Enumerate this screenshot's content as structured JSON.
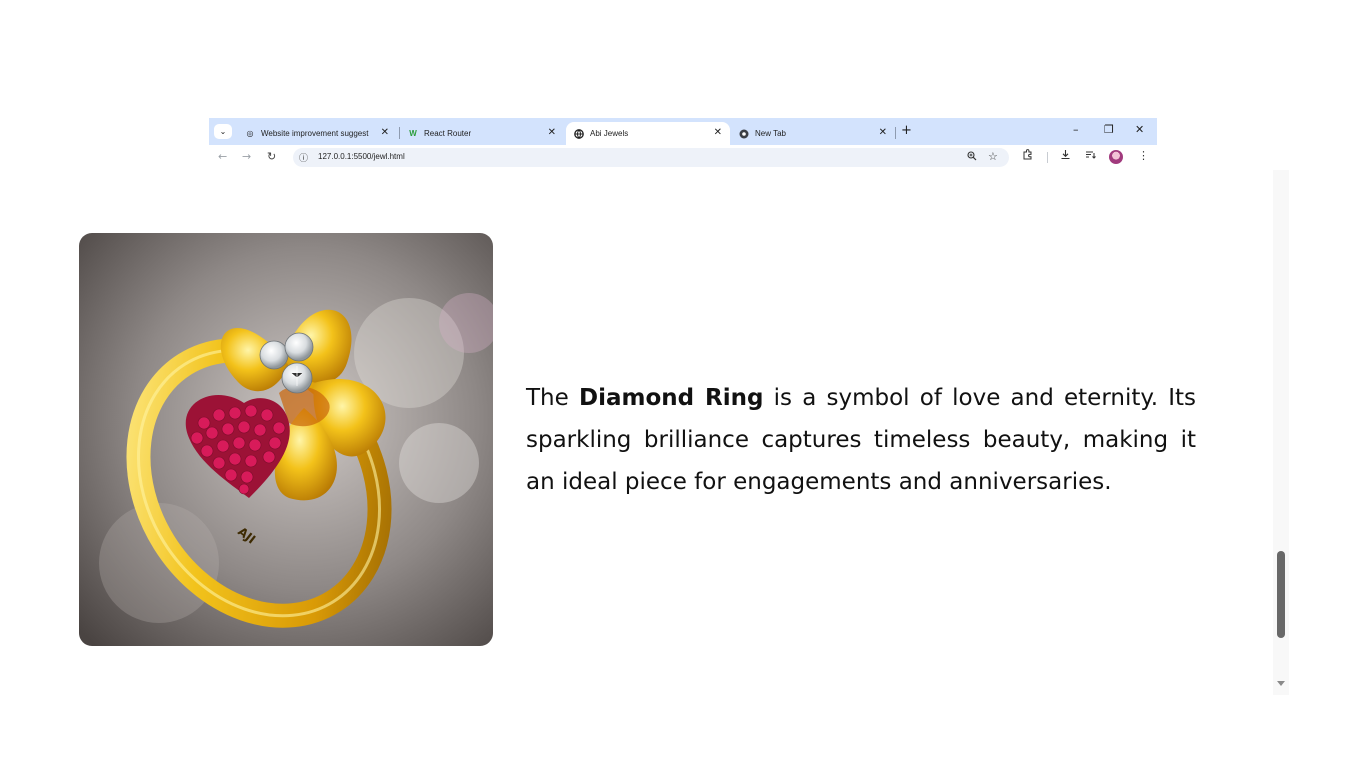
{
  "browser": {
    "tabs": [
      {
        "title": "Website improvement suggesti",
        "favicon": "chatgpt-icon",
        "active": false
      },
      {
        "title": "React Router",
        "favicon": "react-router-icon",
        "active": false
      },
      {
        "title": "Abi Jewels",
        "favicon": "globe-icon",
        "active": true
      },
      {
        "title": "New Tab",
        "favicon": "chrome-icon",
        "active": false
      }
    ],
    "url": "127.0.0.1:5500/jewl.html"
  },
  "product": {
    "image_alt": "gold ring with diamonds and rubies",
    "engraving": "AJI",
    "description_prefix": "The ",
    "description_bold": "Diamond Ring",
    "description_suffix": " is a symbol of love and eternity. Its sparkling brilliance captures timeless beauty, making it an ideal piece for engagements and anniversaries."
  },
  "colors": {
    "tabstrip": "#d3e3fd",
    "gold": "#e8b10f",
    "ruby": "#c2184b",
    "scroll_thumb": "#686868"
  }
}
